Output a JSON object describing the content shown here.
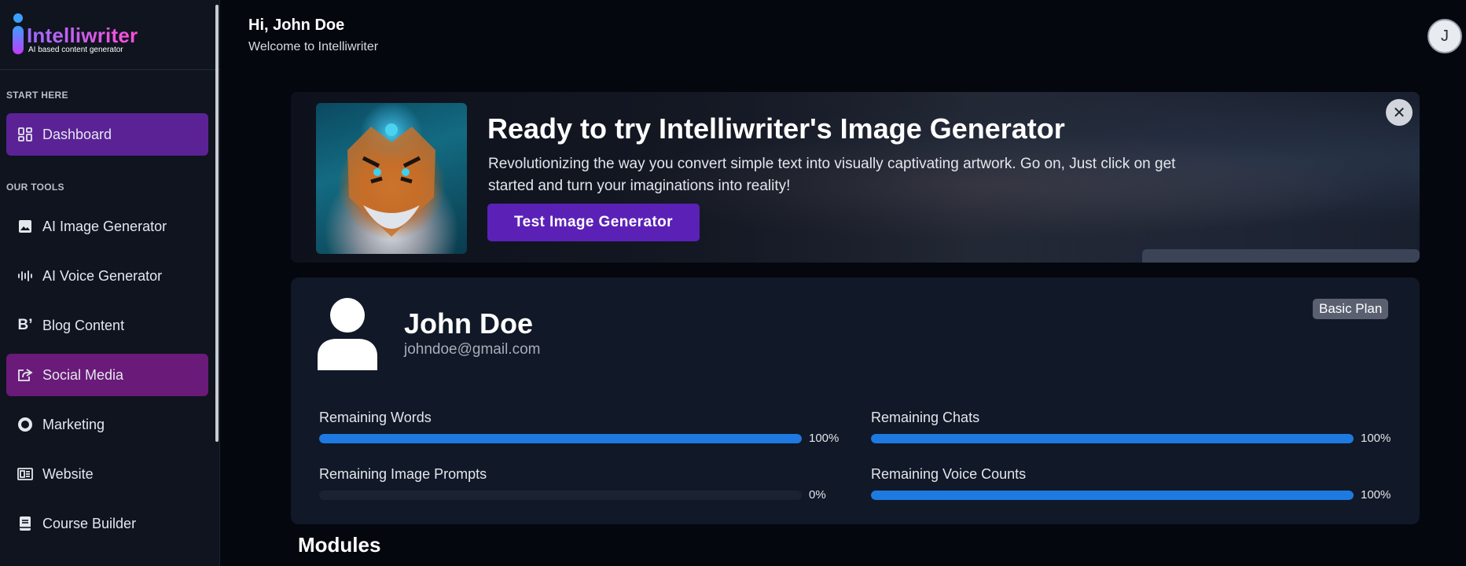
{
  "logo": {
    "name": "Intelliwriter",
    "tagline": "AI based content generator"
  },
  "sidebar": {
    "section_start": "START HERE",
    "section_tools": "OUR TOOLS",
    "items": [
      {
        "label": "Dashboard",
        "icon": "dashboard-icon"
      },
      {
        "label": "AI Image Generator",
        "icon": "image-icon"
      },
      {
        "label": "AI Voice Generator",
        "icon": "voice-wave-icon"
      },
      {
        "label": "Blog Content",
        "icon": "blog-icon"
      },
      {
        "label": "Social Media",
        "icon": "share-icon"
      },
      {
        "label": "Marketing",
        "icon": "circle-icon"
      },
      {
        "label": "Website",
        "icon": "website-icon"
      },
      {
        "label": "Course Builder",
        "icon": "book-icon"
      }
    ]
  },
  "header": {
    "greeting": "Hi, John Doe",
    "welcome": "Welcome to Intelliwriter",
    "avatar_letter": "J"
  },
  "banner": {
    "title": "Ready to try Intelliwriter's Image Generator",
    "description": "Revolutionizing the way you convert simple text into visually captivating artwork. Go on, Just click on get started and turn your imaginations into reality!",
    "button": "Test Image Generator",
    "close": "✕"
  },
  "profile": {
    "name": "John Doe",
    "email": "johndoe@gmail.com",
    "plan": "Basic Plan",
    "stats": [
      {
        "label": "Remaining Words",
        "percent": 100,
        "percent_text": "100%"
      },
      {
        "label": "Remaining Chats",
        "percent": 100,
        "percent_text": "100%"
      },
      {
        "label": "Remaining Image Prompts",
        "percent": 0,
        "percent_text": "0%"
      },
      {
        "label": "Remaining Voice Counts",
        "percent": 100,
        "percent_text": "100%"
      }
    ]
  },
  "modules": {
    "title": "Modules"
  },
  "colors": {
    "accent": "#5b21b6",
    "progress": "#1e7ae0",
    "sidebar_active": "#5b2296",
    "social_active": "#6a1a78"
  }
}
